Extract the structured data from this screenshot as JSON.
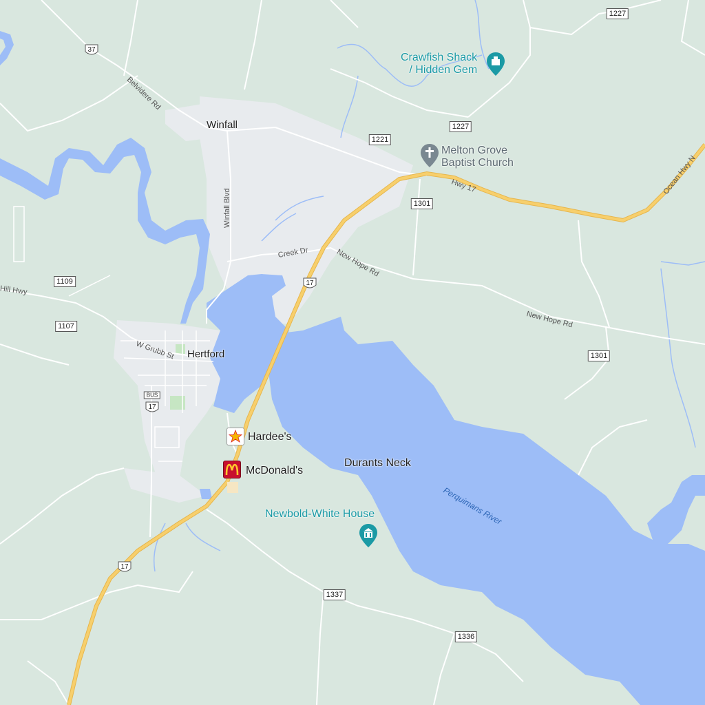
{
  "towns": {
    "winfall": "Winfall",
    "hertford": "Hertford",
    "durants_neck": "Durants Neck"
  },
  "places": {
    "crawfish_line1": "Crawfish Shack",
    "crawfish_line2": "/ Hidden Gem",
    "church_line1": "Melton Grove",
    "church_line2": "Baptist Church",
    "newbold": "Newbold-White House",
    "hardees": "Hardee's",
    "mcdonalds": "McDonald's"
  },
  "roads": {
    "belvidere": "Belvidere Rd",
    "winfall_blvd": "Winfall Blvd",
    "creek_dr": "Creek Dr",
    "new_hope_1": "New Hope Rd",
    "new_hope_2": "New Hope Rd",
    "hwy17": "Hwy 17",
    "ocean_hwy": "Ocean Hwy N",
    "hill_hwy": "Hill Hwy",
    "w_grubb": "W Grubb St"
  },
  "water": {
    "perquimans": "Perquimans River"
  },
  "shields": {
    "r37": "37",
    "r1227a": "1227",
    "r1227b": "1227",
    "r1221": "1221",
    "r1301a": "1301",
    "r1301b": "1301",
    "r1109": "1109",
    "r1107": "1107",
    "r1337": "1337",
    "r1336": "1336",
    "us17a": "17",
    "us17b": "17",
    "us17bus": "17",
    "bus": "BUS"
  },
  "colors": {
    "land": "#d9e7df",
    "water": "#9dbdf7",
    "urban": "#e8ebee",
    "highway": "#f7cf6c",
    "road": "#ffffff",
    "place_teal": "#1b9aa5"
  },
  "icons": {
    "crawfish": "restaurant-pin-icon",
    "church": "church-pin-icon",
    "museum": "museum-pin-icon",
    "hardees": "hardees-logo-icon",
    "mcdonalds": "mcdonalds-logo-icon"
  }
}
